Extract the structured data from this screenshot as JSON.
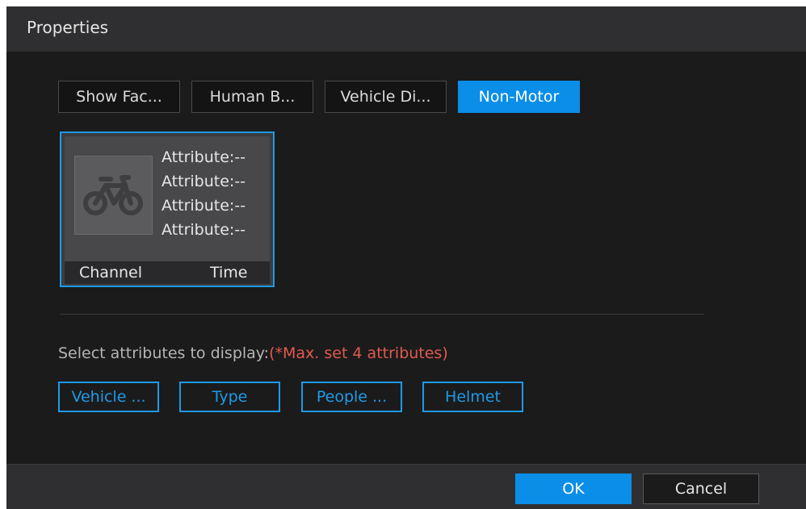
{
  "dialog": {
    "title": "Properties"
  },
  "tabs": [
    {
      "label": "Show Fac...",
      "active": false
    },
    {
      "label": "Human B...",
      "active": false
    },
    {
      "label": "Vehicle Di...",
      "active": false
    },
    {
      "label": "Non-Motor",
      "active": true
    }
  ],
  "preview": {
    "icon": "bicycle-icon",
    "attributes": [
      "Attribute:--",
      "Attribute:--",
      "Attribute:--",
      "Attribute:--"
    ],
    "channel_label": "Channel",
    "time_label": "Time"
  },
  "selection": {
    "prompt": "Select attributes to display:",
    "limit_note": "(*Max. set 4 attributes)",
    "options": [
      "Vehicle ...",
      "Type",
      "People ...",
      "Helmet"
    ]
  },
  "footer": {
    "ok_label": "OK",
    "cancel_label": "Cancel"
  },
  "colors": {
    "accent": "#0a8ee8",
    "warning": "#e05a50"
  }
}
